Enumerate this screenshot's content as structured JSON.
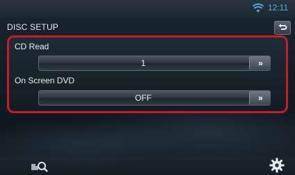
{
  "status_bar": {
    "time": "12:11",
    "wifi_icon": "wifi-icon"
  },
  "header": {
    "title": "DISC SETUP",
    "back_icon": "back-return-icon"
  },
  "settings": [
    {
      "label": "CD Read",
      "value": "1",
      "button_label": "»"
    },
    {
      "label": "On Screen DVD",
      "value": "OFF",
      "button_label": "»"
    }
  ],
  "footer": {
    "left_icon": "media-search-icon",
    "right_icon": "gear-icon"
  },
  "colors": {
    "accent_clock": "#56b0e8",
    "highlight_border": "#cc1a2a"
  }
}
